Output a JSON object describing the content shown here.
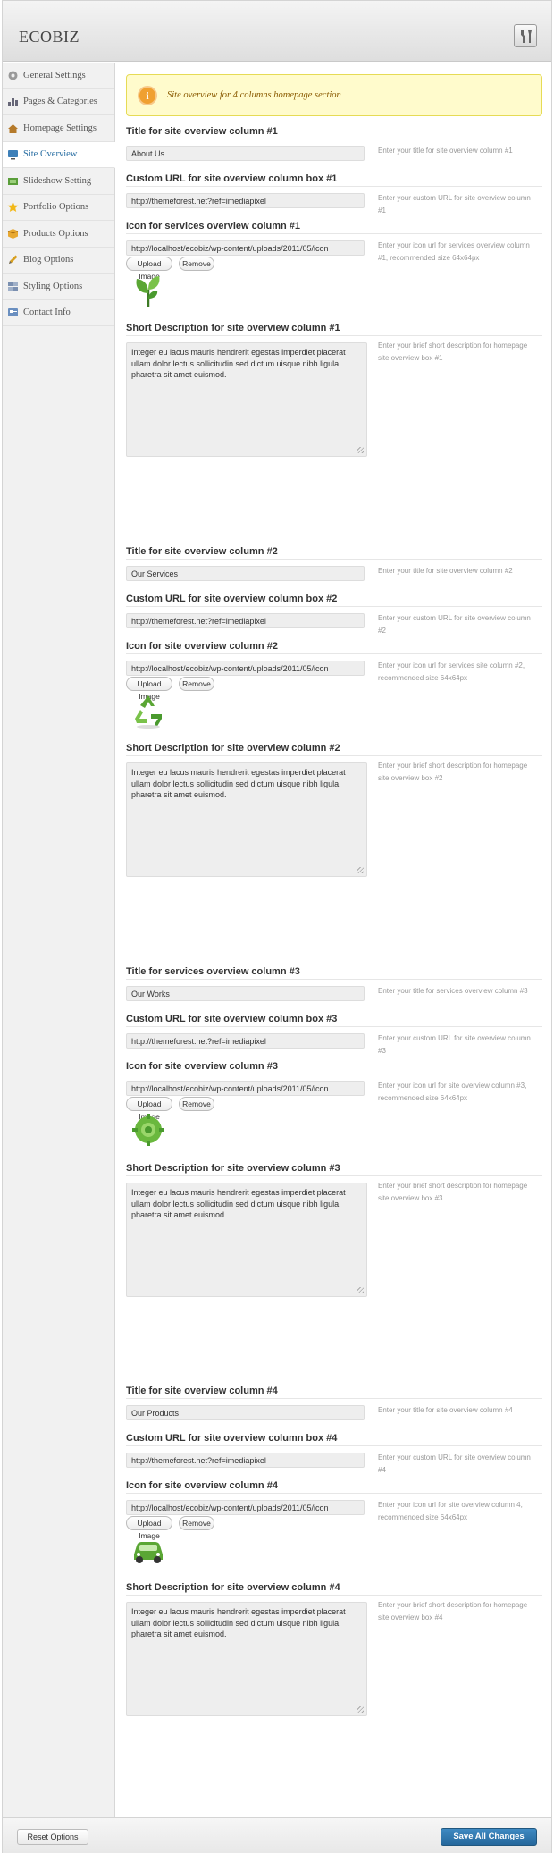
{
  "app": {
    "logo": "ECOBIZ",
    "header_icon": "tools-icon"
  },
  "sidebar": {
    "items": [
      {
        "label": "General Settings",
        "icon": "gear-icon"
      },
      {
        "label": "Pages & Categories",
        "icon": "chart-icon"
      },
      {
        "label": "Homepage Settings",
        "icon": "home-icon"
      },
      {
        "label": "Site Overview",
        "icon": "monitor-icon",
        "active": true
      },
      {
        "label": "Slideshow Setting",
        "icon": "slides-icon"
      },
      {
        "label": "Portfolio Options",
        "icon": "star-icon"
      },
      {
        "label": "Products Options",
        "icon": "box-icon"
      },
      {
        "label": "Blog Options",
        "icon": "pencil-icon"
      },
      {
        "label": "Styling Options",
        "icon": "grid-icon"
      },
      {
        "label": "Contact Info",
        "icon": "card-icon"
      }
    ]
  },
  "notice": {
    "text": "Site overview for 4 columns homepage section"
  },
  "buttons": {
    "upload": "Upload Image",
    "remove": "Remove"
  },
  "columns": [
    {
      "title_label": "Title for site overview column #1",
      "title_value": "About Us",
      "title_help": "Enter your title for site overview column #1",
      "url_label": "Custom URL for site overview column box #1",
      "url_value": "http://themeforest.net?ref=imediapixel",
      "url_help": "Enter your custom URL for site overview column #1",
      "icon_label": "Icon for services overview column #1",
      "icon_value": "http://localhost/ecobiz/wp-content/uploads/2011/05/icon",
      "icon_help": "Enter your icon url for services overview column #1, recommended size 64x64px",
      "icon_image": "plant-icon",
      "desc_label": "Short Description for site overview column #1",
      "desc_value": "Integer eu lacus mauris hendrerit egestas imperdiet placerat ullam dolor lectus sollicitudin sed dictum uisque nibh ligula, pharetra sit amet euismod.",
      "desc_help": "Enter your brief short description for homepage site overview box #1"
    },
    {
      "title_label": "Title for site overview column #2",
      "title_value": "Our Services",
      "title_help": "Enter your title for site overview column #2",
      "url_label": "Custom URL for site overview column box #2",
      "url_value": "http://themeforest.net?ref=imediapixel",
      "url_help": "Enter your custom URL for site overview column #2",
      "icon_label": "Icon for site overview column #2",
      "icon_value": "http://localhost/ecobiz/wp-content/uploads/2011/05/icon",
      "icon_help": "Enter your icon url for services site column #2, recommended size 64x64px",
      "icon_image": "recycle-icon",
      "desc_label": "Short Description for site overview column #2",
      "desc_value": "Integer eu lacus mauris hendrerit egestas imperdiet placerat ullam dolor lectus sollicitudin sed dictum uisque nibh ligula, pharetra sit amet euismod.",
      "desc_help": "Enter your brief short description for homepage site overview box #2"
    },
    {
      "title_label": "Title for services overview column #3",
      "title_value": "Our Works",
      "title_help": "Enter your title for services overview column #3",
      "url_label": "Custom URL for site overview column box #3",
      "url_value": "http://themeforest.net?ref=imediapixel",
      "url_help": "Enter your custom URL for site overview column #3",
      "icon_label": "Icon for site overview column #3",
      "icon_value": "http://localhost/ecobiz/wp-content/uploads/2011/05/icon",
      "icon_help": "Enter your icon url for site overview column #3, recommended size 64x64px",
      "icon_image": "gear-badge-icon",
      "desc_label": "Short Description for site overview column #3",
      "desc_value": "Integer eu lacus mauris hendrerit egestas imperdiet placerat ullam dolor lectus sollicitudin sed dictum uisque nibh ligula, pharetra sit amet euismod.",
      "desc_help": "Enter your brief short description for homepage site overview box #3"
    },
    {
      "title_label": "Title for site overview column #4",
      "title_value": "Our Products",
      "title_help": "Enter your title for site overview column #4",
      "url_label": "Custom URL for site overview column box #4",
      "url_value": "http://themeforest.net?ref=imediapixel",
      "url_help": "Enter your custom URL for site overview column #4",
      "icon_label": "Icon for site overview column #4",
      "icon_value": "http://localhost/ecobiz/wp-content/uploads/2011/05/icon",
      "icon_help": "Enter your icon url for site overview column 4, recommended size 64x64px",
      "icon_image": "car-icon",
      "desc_label": "Short Description for site overview column #4",
      "desc_value": "Integer eu lacus mauris hendrerit egestas imperdiet placerat ullam dolor lectus sollicitudin sed dictum uisque nibh ligula, pharetra sit amet euismod.",
      "desc_help": "Enter your brief short description for homepage site overview box #4"
    }
  ],
  "footer": {
    "reset": "Reset Options",
    "save": "Save All Changes"
  },
  "colors": {
    "accent": "#2a6fa3",
    "save_button": "#2e77ae",
    "notice_bg": "#fffbcc",
    "icon_green": "#4a9a2e"
  }
}
